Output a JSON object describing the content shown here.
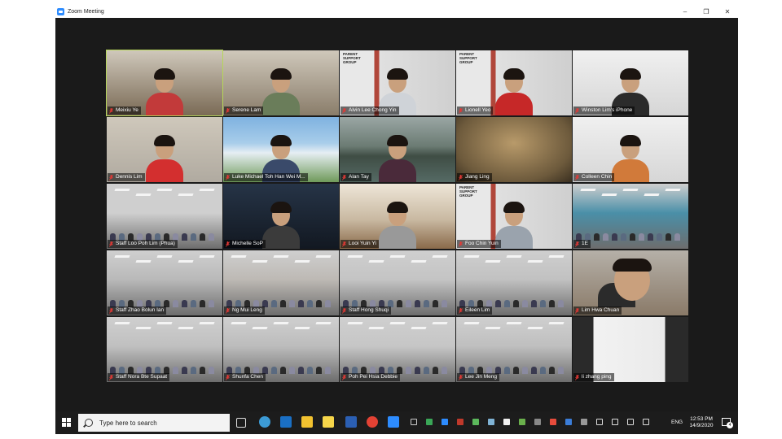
{
  "window": {
    "title": "Zoom Meeting",
    "minimize": "–",
    "restore": "❐",
    "close": "✕"
  },
  "participants": [
    {
      "name": "Meixiu Ye",
      "active": true,
      "scene": "office",
      "tone": "#7a6a55"
    },
    {
      "name": "Serene Lam",
      "scene": "office",
      "tone": "#8a7d6a"
    },
    {
      "name": "Alvin Lee Chong Yin",
      "scene": "psg",
      "tone": "#d9d9d9"
    },
    {
      "name": "Lionell Yeo",
      "scene": "psg",
      "tone": "#d9d9d9"
    },
    {
      "name": "Winston Lim's iPhone",
      "scene": "room",
      "tone": "#e6e6e6"
    },
    {
      "name": "Dennis Lim",
      "scene": "office",
      "tone": "#b0aaa0"
    },
    {
      "name": "Luke Michael Toh Han Wei M...",
      "scene": "campus",
      "tone": "#4a90c9"
    },
    {
      "name": "Alan Tay",
      "scene": "river",
      "tone": "#5f6f6a"
    },
    {
      "name": "Jiang Ling",
      "scene": "screen",
      "tone": "#8a7450"
    },
    {
      "name": "Colleen Chin",
      "scene": "room",
      "tone": "#e8e8e8"
    },
    {
      "name": "Staff Loo Poh Lim (Phua)",
      "scene": "hall",
      "tone": "#cfcfcf"
    },
    {
      "name": "Michelle SoP",
      "scene": "dark",
      "tone": "#1e2a3a"
    },
    {
      "name": "Looi Yuin Yi",
      "scene": "home",
      "tone": "#c9b9a2"
    },
    {
      "name": "Foo Chin Yuin",
      "scene": "psg",
      "tone": "#d9d9d9"
    },
    {
      "name": "1E",
      "scene": "classroom",
      "tone": "#4a8fa8"
    },
    {
      "name": "Staff Zhao Bolun Ian",
      "scene": "hall",
      "tone": "#b9b9b9"
    },
    {
      "name": "Ng Mui Leng",
      "scene": "hall",
      "tone": "#bdb9b4"
    },
    {
      "name": "Staff Hong Shuqi",
      "scene": "hall",
      "tone": "#c4c4c4"
    },
    {
      "name": "Eileen Lim",
      "scene": "hall",
      "tone": "#c1c1c1"
    },
    {
      "name": "Lim Hwa Chuan",
      "scene": "closeup",
      "tone": "#9a8470"
    },
    {
      "name": "Staff Nora Bte Supaat",
      "scene": "hall",
      "tone": "#c0c0c0"
    },
    {
      "name": "Shunfa Chen",
      "scene": "hall",
      "tone": "#bcbcbc"
    },
    {
      "name": "Poh Pei Hsia Debbie",
      "scene": "hall",
      "tone": "#c6c6c6"
    },
    {
      "name": "Lee Jin Meng",
      "scene": "hall",
      "tone": "#bfbfbf"
    },
    {
      "name": "li zhang ping",
      "scene": "art",
      "tone": "#ececec"
    }
  ],
  "psg_sign": "PARENT SUPPORT GROUP",
  "taskbar": {
    "search_placeholder": "Type here to search",
    "language": "ENG",
    "time": "12:53 PM",
    "date": "14/9/2020",
    "notifications": "4",
    "apps": [
      {
        "icon": "task-view-icon",
        "color": "#dddddd"
      },
      {
        "icon": "edge-icon",
        "color": "#3c9bd6"
      },
      {
        "icon": "outlook-icon",
        "color": "#1a6fc4"
      },
      {
        "icon": "file-explorer-icon",
        "color": "#f2c230"
      },
      {
        "icon": "sticky-notes-icon",
        "color": "#f7d64a"
      },
      {
        "icon": "word-icon",
        "color": "#2b5fb3"
      },
      {
        "icon": "chrome-icon",
        "color": "#e34234"
      },
      {
        "icon": "zoom-icon",
        "color": "#2d8cff"
      }
    ],
    "tray": [
      {
        "icon": "usb-icon",
        "color": "#cccccc"
      },
      {
        "icon": "shield-icon",
        "color": "#3aa757"
      },
      {
        "icon": "zoom-tray-icon",
        "color": "#2d8cff"
      },
      {
        "icon": "app-tray-icon",
        "color": "#c0392b"
      },
      {
        "icon": "app-tray-icon",
        "color": "#5cb85c"
      },
      {
        "icon": "app-tray-icon",
        "color": "#7fb3d5"
      },
      {
        "icon": "app-tray-icon",
        "color": "#f0f0f0"
      },
      {
        "icon": "app-tray-icon",
        "color": "#6ab04c"
      },
      {
        "icon": "app-tray-icon",
        "color": "#888888"
      },
      {
        "icon": "app-tray-icon",
        "color": "#e74c3c"
      },
      {
        "icon": "bluetooth-icon",
        "color": "#3b7dd8"
      },
      {
        "icon": "app-tray-icon",
        "color": "#999999"
      },
      {
        "icon": "battery-icon",
        "color": "#dddddd"
      },
      {
        "icon": "wifi-icon",
        "color": "#dddddd"
      },
      {
        "icon": "volume-icon",
        "color": "#dddddd"
      },
      {
        "icon": "pen-icon",
        "color": "#dddddd"
      }
    ]
  }
}
